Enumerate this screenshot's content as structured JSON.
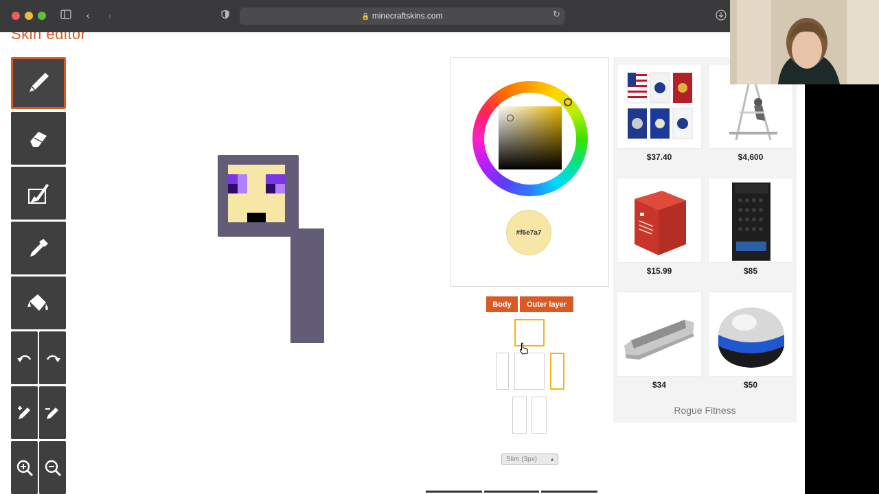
{
  "browser": {
    "url": "minecraftskins.com"
  },
  "page": {
    "title": "Skin editor"
  },
  "tools": [
    {
      "name": "pencil",
      "active": true
    },
    {
      "name": "eraser",
      "active": false
    },
    {
      "name": "brush",
      "active": false
    },
    {
      "name": "eyedropper",
      "active": false
    },
    {
      "name": "bucket",
      "active": false
    },
    {
      "name": "undo",
      "active": false
    },
    {
      "name": "redo",
      "active": false
    },
    {
      "name": "lighten",
      "active": false
    },
    {
      "name": "darken",
      "active": false
    },
    {
      "name": "zoom-in",
      "active": false
    },
    {
      "name": "zoom-out",
      "active": false
    }
  ],
  "color_picker": {
    "current_color": "#f6e7a7",
    "hex_label": "#f6e7a7"
  },
  "layers": {
    "body_label": "Body",
    "outer_label": "Outer layer"
  },
  "model_select": {
    "selected": "Slim (3px)"
  },
  "skin_colors": {
    "outline": "#625c77",
    "face": "#f6e7a7",
    "eye_purple": "#7a35e6",
    "eye_light": "#b080ff",
    "eye_dark": "#2d0d66",
    "mouth": "#000000"
  },
  "ads": {
    "items": [
      {
        "price": "$37.40"
      },
      {
        "price": "$4,600"
      },
      {
        "price": "$15.99"
      },
      {
        "price": "$85"
      },
      {
        "price": "$34"
      },
      {
        "price": "$50"
      }
    ],
    "brand": "Rogue Fitness"
  },
  "accent_color": "#d95a24"
}
